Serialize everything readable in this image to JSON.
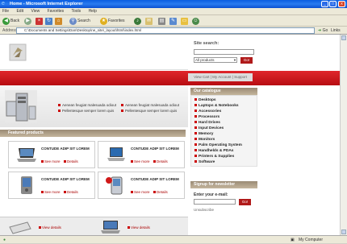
{
  "window": {
    "title": "Home - Microsoft Internet Explorer"
  },
  "menu": [
    "File",
    "Edit",
    "View",
    "Favorites",
    "Tools",
    "Help"
  ],
  "toolbar": {
    "back": "Back",
    "search": "Search",
    "favorites": "Favorites"
  },
  "address": {
    "label": "Address",
    "url": "C:\\Documents and Settings\\Dan\\Desktop\\ne_site\\_layout\\html\\index.html",
    "go": "Go",
    "links": "Links"
  },
  "status": {
    "computer": "My Computer"
  },
  "site": {
    "search_title": "Site search:",
    "search_select": "All products",
    "search_go": "Go!",
    "user_links": "View Cart | My Account | Support",
    "hero_links": [
      "Aenean feugiat malesuada odiout",
      "Pellentesque semper lorem quis",
      "Aenean feugiat malesuada odiout",
      "Pellentesque semper lorem quis"
    ],
    "featured_header": "Featured products",
    "products": [
      {
        "title": "CONTUDE ADIP SIT LOREM",
        "see_more": "See more",
        "details": "Details"
      },
      {
        "title": "CONTUDE ADIP SIT LOREM",
        "see_more": "See more",
        "details": "Details"
      },
      {
        "title": "CONTUDE ADIP SIT LOREM",
        "see_more": "See more",
        "details": "Details"
      },
      {
        "title": "CONTUDE ADIP SIT LOREM",
        "see_more": "See more",
        "details": "Details"
      }
    ],
    "bottom_links": [
      "View details",
      "View details"
    ],
    "catalogue_header": "Our catalogue",
    "categories": [
      "Desktops",
      "Laptops & Notebooks",
      "Accessories",
      "Processors",
      "Hard Drives",
      "Input Devices",
      "Memory",
      "Monitors",
      "Palm Operating System",
      "Handhelds & PDAs",
      "Printers & Supplies",
      "Software"
    ],
    "newsletter_header": "Signup for newsletter",
    "newsletter_label": "Enter your e-mail:",
    "newsletter_go": "Go!",
    "unsubscribe": "Unsubscribe"
  },
  "colors": {
    "accent": "#c8141a",
    "section": "#a8977f",
    "titlebar": "#0a5de0"
  }
}
